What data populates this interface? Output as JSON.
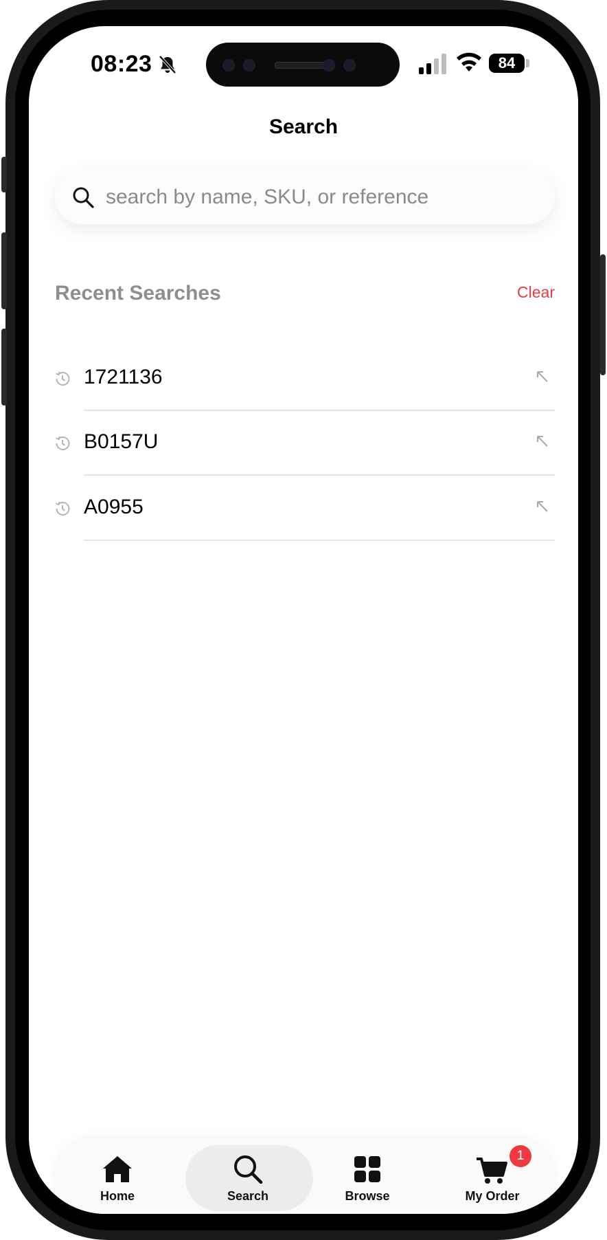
{
  "status_bar": {
    "time": "08:23",
    "battery": "84"
  },
  "header": {
    "title": "Search"
  },
  "search": {
    "placeholder": "search by name, SKU, or reference"
  },
  "recent": {
    "heading": "Recent Searches",
    "clear_label": "Clear",
    "items": [
      {
        "label": "1721136"
      },
      {
        "label": "B0157U"
      },
      {
        "label": "A0955"
      }
    ]
  },
  "tabbar": {
    "tabs": [
      {
        "label": "Home",
        "icon": "home-icon"
      },
      {
        "label": "Search",
        "icon": "search-icon"
      },
      {
        "label": "Browse",
        "icon": "grid-icon"
      },
      {
        "label": "My Order",
        "icon": "cart-icon"
      }
    ],
    "active_tab": "Search",
    "cart_badge": "1"
  },
  "colors": {
    "accent_red": "#ee3b3b",
    "badge_red": "#ef3842",
    "muted_gray": "#8e8e8e"
  }
}
